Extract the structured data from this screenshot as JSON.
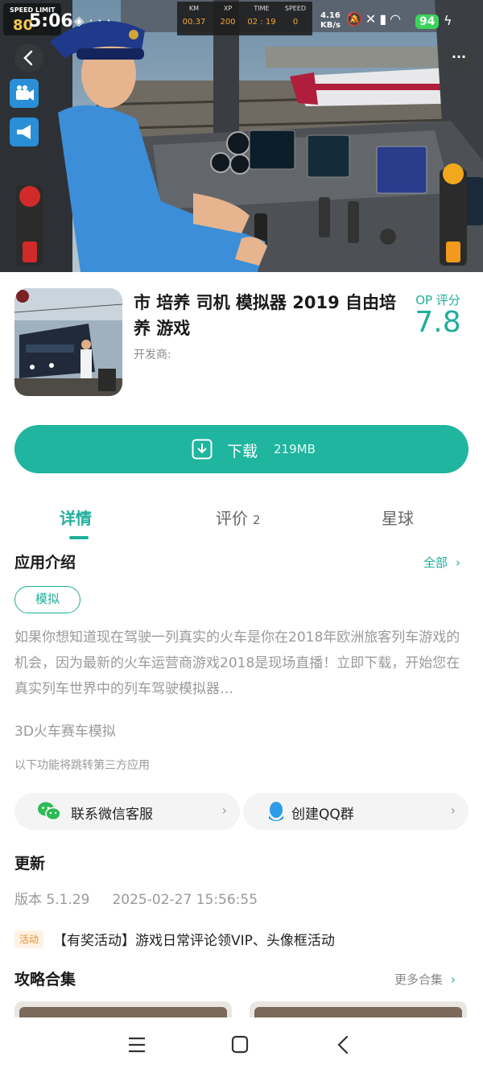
{
  "status_bar": {
    "time": "5:06",
    "net_speed_value": "4.16",
    "net_speed_unit": "KB/s",
    "battery": "94",
    "icons": [
      "wechat-status-icon",
      "more-dots-icon",
      "mute-icon",
      "sim-off-icon",
      "signal-icon",
      "wifi-icon",
      "charging-icon"
    ]
  },
  "hero": {
    "speed_limit_label": "SPEED LIMIT",
    "speed_limit_value": "80",
    "hud": [
      {
        "label": "KM",
        "value": "00.37"
      },
      {
        "label": "XP",
        "value": "200"
      },
      {
        "label": "TIME",
        "value": "02 : 19"
      },
      {
        "label": "SPEED",
        "value": "0"
      }
    ],
    "more_label": "···"
  },
  "app": {
    "title": "市 培养 司机 模拟器 2019 自由培养 游戏",
    "developer_label": "开发商:",
    "rating_label": "OP 评分",
    "rating_value": "7.8"
  },
  "download": {
    "label": "下载",
    "size": "219MB"
  },
  "tabs": [
    {
      "label": "详情",
      "count": "",
      "active": true
    },
    {
      "label": "评价",
      "count": "2",
      "active": false
    },
    {
      "label": "星球",
      "count": "",
      "active": false
    }
  ],
  "intro": {
    "title": "应用介绍",
    "all_label": "全部",
    "tag": "模拟",
    "text": "如果你想知道现在驾驶一列真实的火车是你在2018年欧洲旅客列车游戏的机会，因为最新的火车运营商游戏2018是现场直播！立即下载，开始您在真实列车世界中的列车驾驶模拟器…",
    "tagline": "3D火车赛车模拟",
    "third_party_note": "以下功能将跳转第三方应用"
  },
  "contacts": [
    {
      "label": "联系微信客服",
      "icon": "wechat-icon"
    },
    {
      "label": "创建QQ群",
      "icon": "qq-icon"
    }
  ],
  "update": {
    "title": "更新",
    "version": "版本 5.1.29",
    "date": "2025-02-27 15:56:55"
  },
  "activity": {
    "badge": "活动",
    "text": "【有奖活动】游戏日常评论领VIP、头像框活动"
  },
  "guides": {
    "title": "攻略合集",
    "more_label": "更多合集"
  },
  "nav": {
    "buttons": [
      "menu-icon",
      "home-icon",
      "back-icon"
    ]
  },
  "colors": {
    "accent": "#1fae9c",
    "download_button": "#1fb59f",
    "activity_badge": "#f08a24",
    "battery": "#3bd35a"
  }
}
